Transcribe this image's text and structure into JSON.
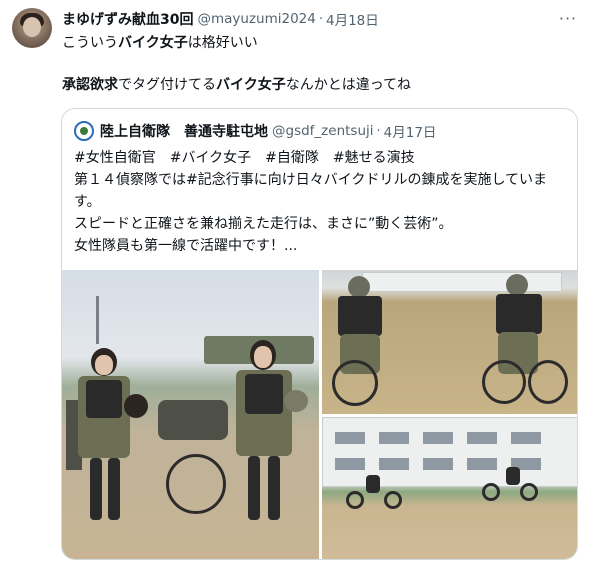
{
  "tweet": {
    "display_name": "まゆげずみ献血30回",
    "handle": "@mayuzumi2024",
    "separator": "·",
    "date": "4月18日",
    "more_label": "···",
    "text_line1_a": "こういう",
    "text_line1_b": "バイク女子",
    "text_line1_c": "は格好いい",
    "text_line2_a": "承認欲求",
    "text_line2_b": "でタグ付けてる",
    "text_line2_c": "バイク女子",
    "text_line2_d": "なんかとは違ってね"
  },
  "quote": {
    "display_name": "陸上自衛隊　善通寺駐屯地",
    "handle": "@gsdf_zentsuji",
    "separator": "·",
    "date": "4月17日",
    "lines": [
      "#女性自衛官　#バイク女子　#自衛隊　#魅せる演技",
      "第１４偵察隊では#記念行事に向け日々バイクドリルの錬成を実施していま",
      "す。",
      "スピードと正確さを兼ね揃えた走行は、まさに”動く芸術”。",
      "女性隊員も第一線で活躍中です！..."
    ]
  },
  "icons": {
    "avatar": "user-avatar",
    "quote_avatar": "gsdf-emblem-icon",
    "more": "more-options-icon"
  },
  "colors": {
    "text": "#0f1419",
    "secondary": "#536471",
    "border": "#cfd9de"
  }
}
